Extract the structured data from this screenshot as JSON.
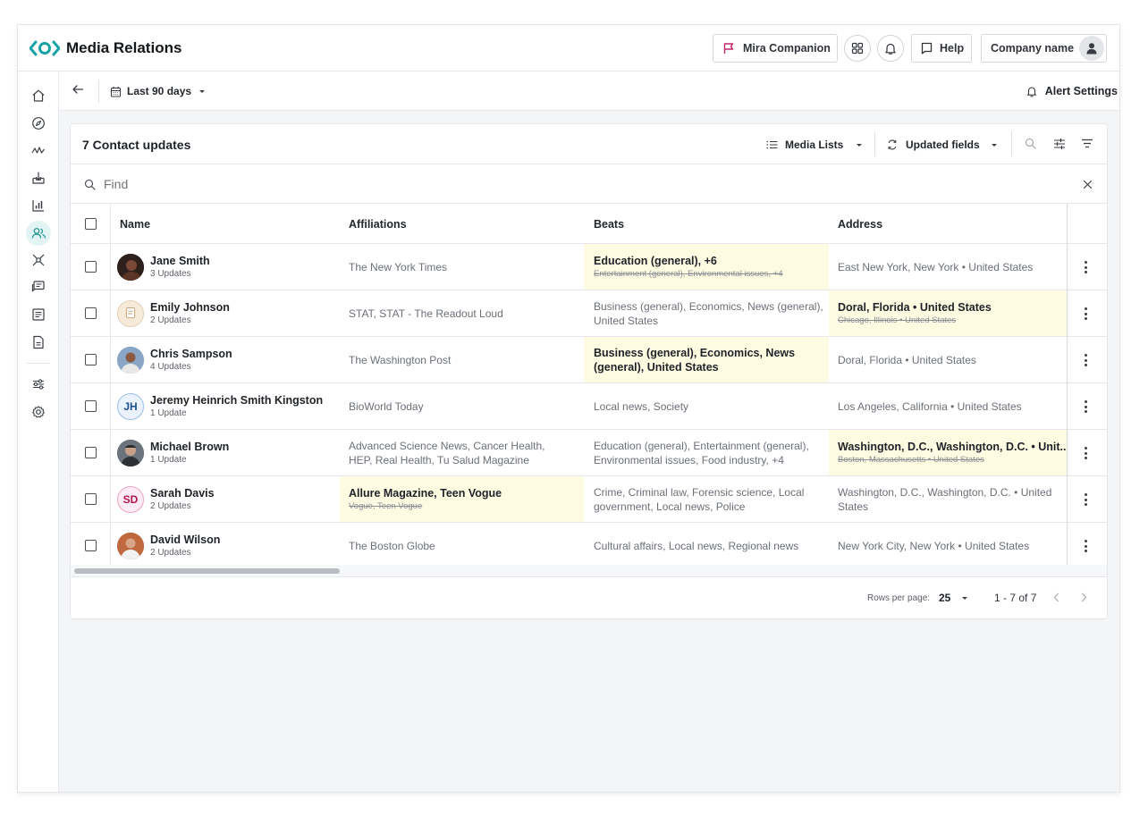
{
  "header": {
    "app_title": "Media Relations",
    "companion_label": "Mira Companion",
    "help_label": "Help",
    "company_label": "Company name"
  },
  "subbar": {
    "date_range": "Last 90 days",
    "alert_settings": "Alert Settings"
  },
  "card": {
    "title": "7 Contact updates",
    "media_lists": "Media Lists",
    "updated_fields": "Updated fields",
    "find_placeholder": "Find"
  },
  "columns": {
    "name": "Name",
    "affiliations": "Affiliations",
    "beats": "Beats",
    "address": "Address"
  },
  "rows": [
    {
      "name": "Jane Smith",
      "updates": "3 Updates",
      "affiliations": "The New York Times",
      "affiliations_old": "",
      "beats": "Education (general), +6",
      "beats_old": "Entertainment (general), Environmental issues, +4",
      "address": "East New York, New York • United States",
      "address_old": ""
    },
    {
      "name": "Emily Johnson",
      "updates": "2 Updates",
      "affiliations": "STAT, STAT - The Readout Loud",
      "affiliations_old": "",
      "beats": "Business (general), Economics, News (general), United States",
      "beats_old": "",
      "address": "Doral, Florida • United States",
      "address_old": "Chicago, Illinois • United States"
    },
    {
      "name": "Chris Sampson",
      "updates": "4 Updates",
      "affiliations": "The Washington Post",
      "affiliations_old": "",
      "beats": "Business (general), Economics, News (general), United States",
      "beats_old": "",
      "address": "Doral, Florida • United States",
      "address_old": ""
    },
    {
      "name": "Jeremy Heinrich Smith Kingston",
      "updates": "1 Update",
      "initials": "JH",
      "affiliations": "BioWorld Today",
      "affiliations_old": "",
      "beats": "Local news, Society",
      "beats_old": "",
      "address": "Los Angeles, California • United States",
      "address_old": ""
    },
    {
      "name": "Michael Brown",
      "updates": "1 Update",
      "affiliations": "Advanced Science News, Cancer Health, HEP, Real Health, Tu Salud Magazine",
      "affiliations_old": "",
      "beats": "Education (general), Entertainment (general), Environmental issues, Food industry, +4",
      "beats_old": "",
      "address": "Washington, D.C., Washington, D.C. • Unit...",
      "address_old": "Boston, Massachusetts • United States"
    },
    {
      "name": "Sarah Davis",
      "updates": "2 Updates",
      "initials": "SD",
      "affiliations": "Allure Magazine, Teen Vogue",
      "affiliations_old": "Vogue, Teen Vogue",
      "beats": "Crime, Criminal law, Forensic science, Local government, Local news, Police",
      "beats_old": "",
      "address": "Washington, D.C., Washington, D.C. • United States",
      "address_old": ""
    },
    {
      "name": "David Wilson",
      "updates": "2 Updates",
      "affiliations": "The Boston Globe",
      "affiliations_old": "",
      "beats": "Cultural affairs, Local news, Regional news",
      "beats_old": "",
      "address": "New York City, New York • United States",
      "address_old": ""
    }
  ],
  "pager": {
    "rows_per_page_label": "Rows per page:",
    "rows_per_page_value": "25",
    "range": "1 - 7 of 7"
  },
  "colors": {
    "brand": "#1aa3a6",
    "highlight": "#fefbe3",
    "companion_accent": "#c2266a"
  }
}
